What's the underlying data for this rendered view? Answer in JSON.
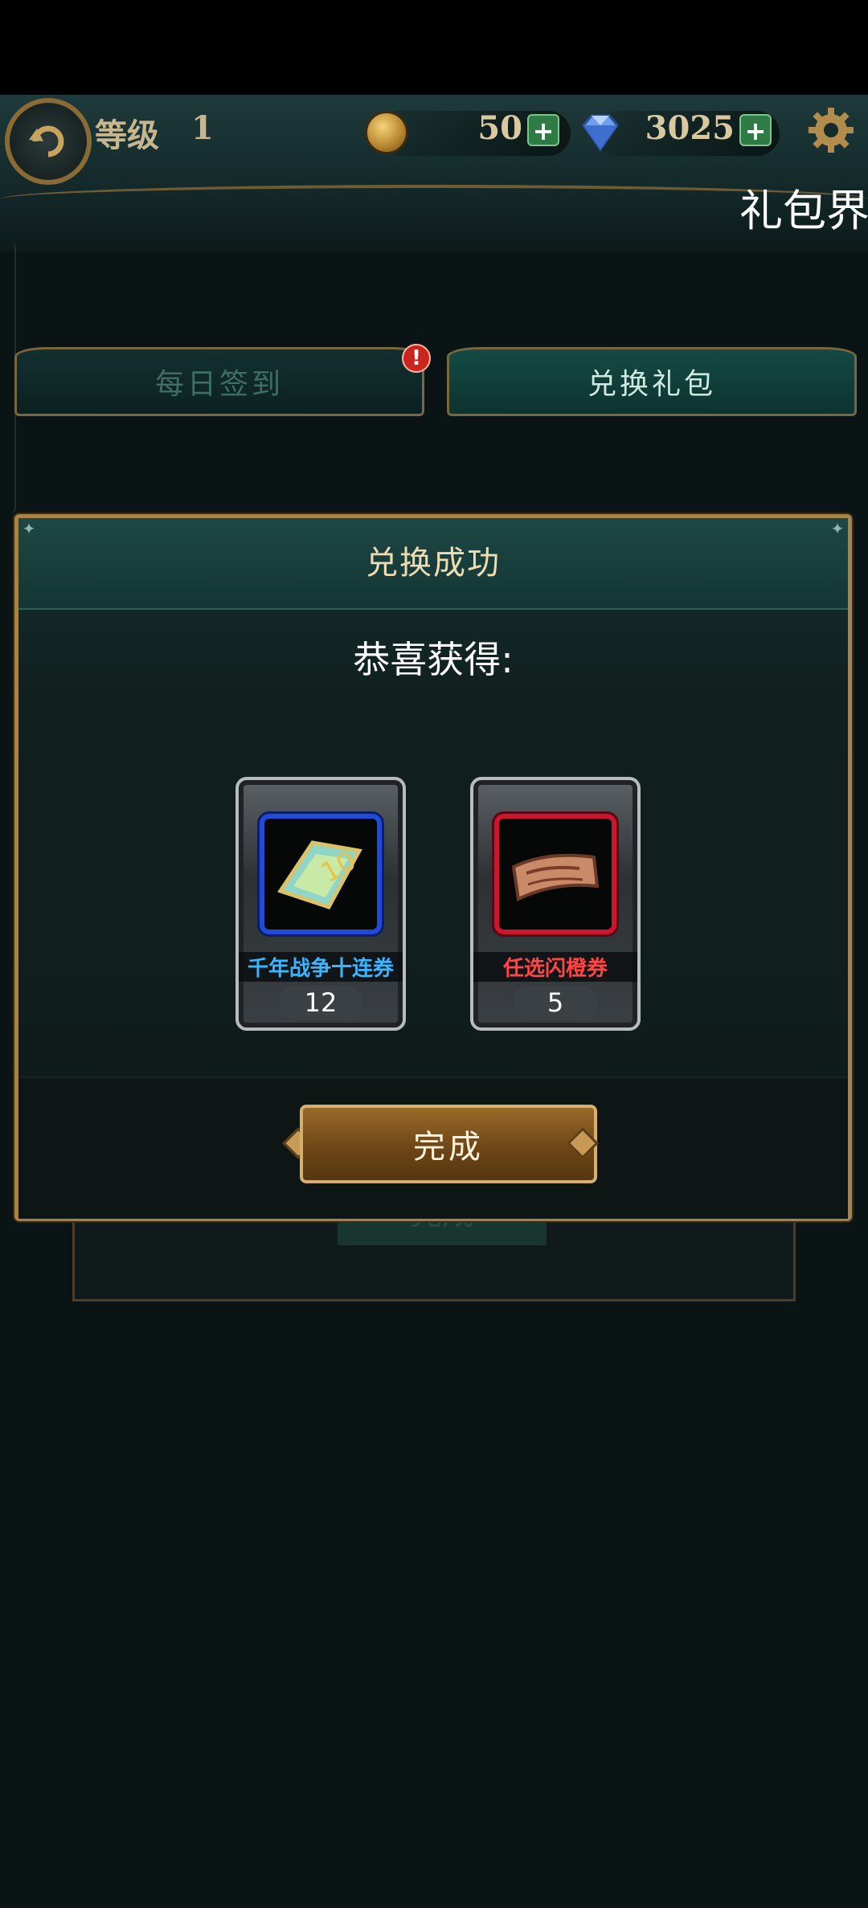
{
  "header": {
    "level_label": "等级",
    "level_value": "1",
    "gold": "50",
    "diamonds": "3025",
    "plus": "+",
    "page_label": "礼包界"
  },
  "tabs": {
    "daily_checkin": "每日签到",
    "redeem_gift": "兑换礼包",
    "badge": "!"
  },
  "background_dialog": {
    "button_label": "完成"
  },
  "modal": {
    "title": "兑换成功",
    "congrats": "恭喜获得:",
    "rewards": [
      {
        "name": "千年战争十连券",
        "count": "12",
        "frame_color": "#1f4bd8",
        "icon": "ten-pull-ticket-icon"
      },
      {
        "name": "任选闪橙券",
        "count": "5",
        "frame_color": "#cc1630",
        "icon": "orange-select-ticket-icon"
      }
    ],
    "done_label": "完成"
  },
  "colors": {
    "accent_gold": "#a7834a",
    "panel_teal": "#1d4744"
  }
}
